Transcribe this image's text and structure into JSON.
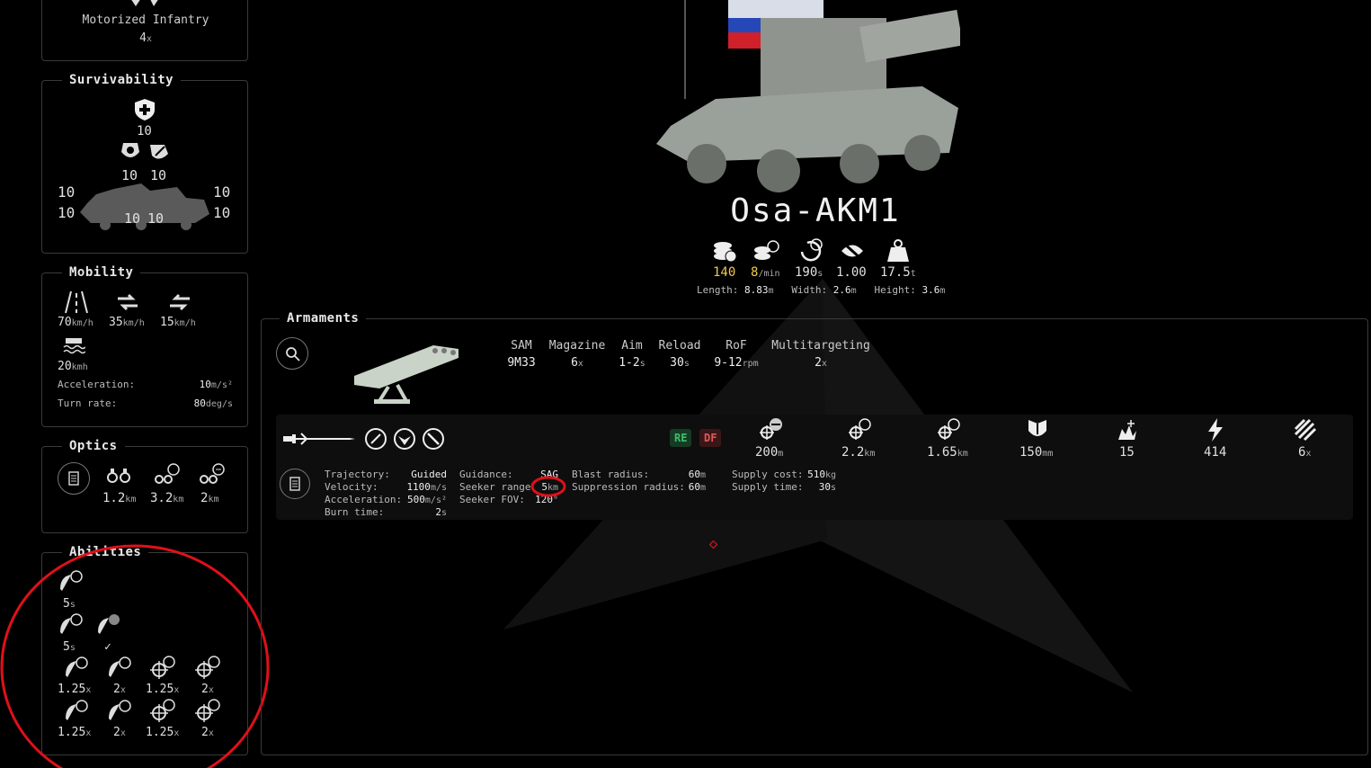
{
  "unit": {
    "name": "Osa-AKM1",
    "stats": [
      {
        "value": "140",
        "unit": "",
        "color": "#f2c94c"
      },
      {
        "value": "8",
        "unit": "/min",
        "color": "#f2c94c"
      },
      {
        "value": "190",
        "unit": "s",
        "color": "#e0e0e0"
      },
      {
        "value": "1.00",
        "unit": "",
        "color": "#e0e0e0"
      },
      {
        "value": "17.5",
        "unit": "t",
        "color": "#e0e0e0"
      }
    ],
    "dims": {
      "length_label": "Length:",
      "length_val": "8.83",
      "length_unit": "m",
      "width_label": "Width:",
      "width_val": "2.6",
      "width_unit": "m",
      "height_label": "Height:",
      "height_val": "3.6",
      "height_unit": "m"
    }
  },
  "transport": {
    "label": "Motorized Infantry",
    "count": "4",
    "count_unit": "x"
  },
  "survivability": {
    "title": "Survivability",
    "top": "10",
    "left_top": "10",
    "right_top": "10",
    "front_top": "10",
    "front_bottom": "10",
    "rear_top": "10",
    "rear_bottom": "10",
    "bottom_left": "10",
    "bottom_right": "10"
  },
  "mobility": {
    "title": "Mobility",
    "speeds": [
      {
        "value": "70",
        "unit": "km/h"
      },
      {
        "value": "35",
        "unit": "km/h"
      },
      {
        "value": "15",
        "unit": "km/h"
      }
    ],
    "water": {
      "value": "20",
      "unit": "kmh"
    },
    "acc_label": "Acceleration:",
    "acc_val": "10",
    "acc_unit": "m/s²",
    "turn_label": "Turn rate:",
    "turn_val": "80",
    "turn_unit": "deg/s"
  },
  "optics": {
    "title": "Optics",
    "values": [
      {
        "value": "1.2",
        "unit": "km"
      },
      {
        "value": "3.2",
        "unit": "km"
      },
      {
        "value": "2",
        "unit": "km"
      }
    ]
  },
  "abilities": {
    "title": "Abilities",
    "row1": [
      {
        "value": "5",
        "unit": "s"
      }
    ],
    "row2": [
      {
        "value": "5",
        "unit": "s"
      },
      {
        "value": "✓",
        "unit": ""
      }
    ],
    "row3": [
      {
        "value": "1.25",
        "unit": "x"
      },
      {
        "value": "2",
        "unit": "x"
      },
      {
        "value": "1.25",
        "unit": "x"
      },
      {
        "value": "2",
        "unit": "x"
      }
    ],
    "row4": [
      {
        "value": "1.25",
        "unit": "x"
      },
      {
        "value": "2",
        "unit": "x"
      },
      {
        "value": "1.25",
        "unit": "x"
      },
      {
        "value": "2",
        "unit": "x"
      }
    ]
  },
  "armaments": {
    "title": "Armaments",
    "columns": [
      {
        "label": "SAM",
        "value": "9M33",
        "unit": ""
      },
      {
        "label": "Magazine",
        "value": "6",
        "unit": "x"
      },
      {
        "label": "Aim",
        "value": "1-2",
        "unit": "s"
      },
      {
        "label": "Reload",
        "value": "30",
        "unit": "s"
      },
      {
        "label": "RoF",
        "value": "9-12",
        "unit": "rpm"
      },
      {
        "label": "Multitargeting",
        "value": "2",
        "unit": "x"
      }
    ],
    "badges": {
      "re": "RE",
      "df": "DF"
    },
    "ammo_stats": [
      {
        "value": "200",
        "unit": "m"
      },
      {
        "value": "2.2",
        "unit": "km"
      },
      {
        "value": "1.65",
        "unit": "km"
      },
      {
        "value": "150",
        "unit": "mm"
      },
      {
        "value": "15",
        "unit": ""
      },
      {
        "value": "414",
        "unit": ""
      },
      {
        "value": "6",
        "unit": "x"
      }
    ],
    "details": {
      "trajectory_label": "Trajectory:",
      "trajectory_val": "Guided",
      "velocity_label": "Velocity:",
      "velocity_val": "1100",
      "velocity_unit": "m/s",
      "accel_label": "Acceleration:",
      "accel_val": "500",
      "accel_unit": "m/s²",
      "burn_label": "Burn time:",
      "burn_val": "2",
      "burn_unit": "s",
      "guidance_label": "Guidance:",
      "guidance_val": "SAG",
      "seeker_range_label": "Seeker range",
      "seeker_range_val": "5",
      "seeker_range_unit": "km",
      "seeker_fov_label": "Seeker FOV:",
      "seeker_fov_val": "120",
      "seeker_fov_unit": "°",
      "blast_label": "Blast radius:",
      "blast_val": "60",
      "blast_unit": "m",
      "supp_label": "Suppression radius:",
      "supp_val": "60",
      "supp_unit": "m",
      "supply_cost_label": "Supply cost:",
      "supply_cost_val": "510",
      "supply_cost_unit": "kg",
      "supply_time_label": "Supply time:",
      "supply_time_val": "30",
      "supply_time_unit": "s"
    }
  },
  "colors": {
    "accent_yellow": "#f2c94c",
    "annotation_red": "#e0101a",
    "re_green": "#3fbf6a",
    "df_red": "#e05a5a"
  }
}
